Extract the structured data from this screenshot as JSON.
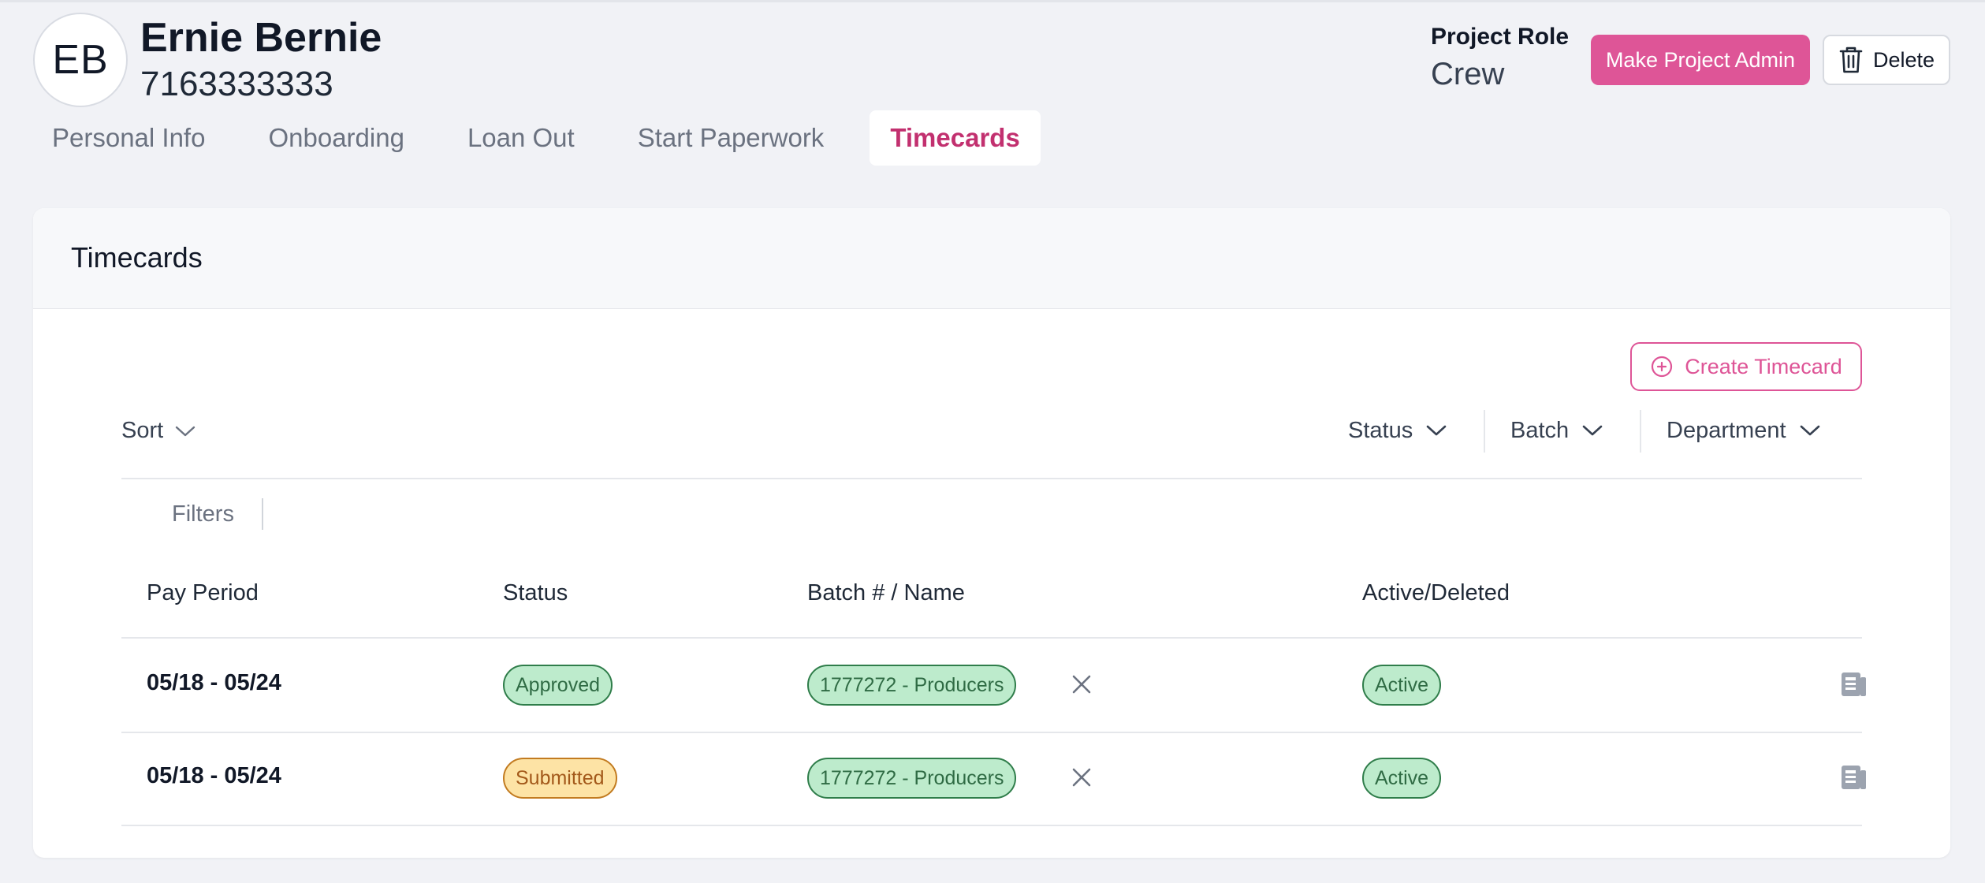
{
  "colors": {
    "accent": "#de5597",
    "accent_text": "#c2306f",
    "page_bg": "#f1f2f6",
    "badge_green_bg": "#bdebcc",
    "badge_green_border": "#2f7d4a",
    "badge_yellow_bg": "#fde3a5",
    "badge_yellow_border": "#c27b20"
  },
  "header": {
    "avatar_initials": "EB",
    "name": "Ernie Bernie",
    "phone": "7163333333",
    "role_label": "Project Role",
    "role_value": "Crew",
    "make_admin_label": "Make Project Admin",
    "delete_label": "Delete",
    "delete_icon": "trash-icon"
  },
  "tabs": [
    {
      "label": "Personal Info",
      "active": false
    },
    {
      "label": "Onboarding",
      "active": false
    },
    {
      "label": "Loan Out",
      "active": false
    },
    {
      "label": "Start Paperwork",
      "active": false
    },
    {
      "label": "Timecards",
      "active": true
    }
  ],
  "card": {
    "title": "Timecards",
    "create_label": "Create Timecard",
    "create_icon": "plus-circle-icon",
    "sort_label": "Sort",
    "dropdowns": [
      {
        "label": "Status",
        "icon": "chevron-down-icon"
      },
      {
        "label": "Batch",
        "icon": "chevron-down-icon"
      },
      {
        "label": "Department",
        "icon": "chevron-down-icon"
      }
    ],
    "filters_label": "Filters"
  },
  "table": {
    "columns": [
      "Pay Period",
      "Status",
      "Batch # / Name",
      "Active/Deleted"
    ],
    "rows": [
      {
        "pay_period": "05/18 - 05/24",
        "status": "Approved",
        "status_color": "green",
        "batch": "1777272 - Producers",
        "active": "Active",
        "remove_icon": "close-icon",
        "row_icon": "timecard-icon"
      },
      {
        "pay_period": "05/18 - 05/24",
        "status": "Submitted",
        "status_color": "yellow",
        "batch": "1777272 - Producers",
        "active": "Active",
        "remove_icon": "close-icon",
        "row_icon": "timecard-icon"
      }
    ]
  }
}
